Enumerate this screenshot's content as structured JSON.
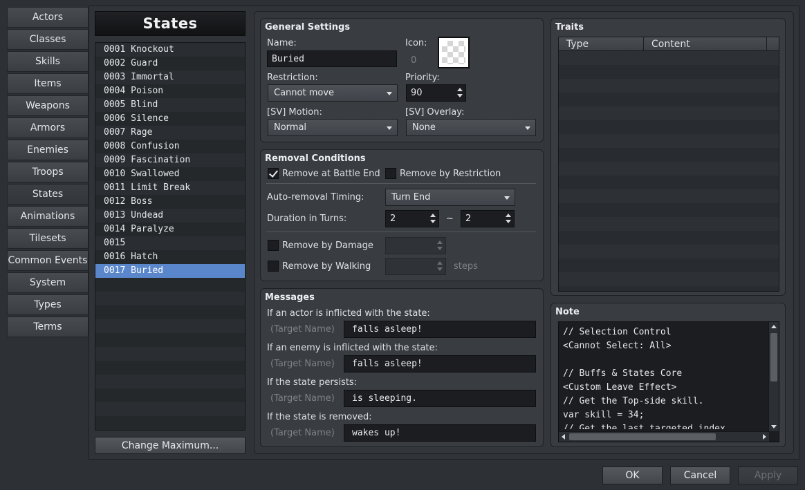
{
  "nav": [
    "Actors",
    "Classes",
    "Skills",
    "Items",
    "Weapons",
    "Armors",
    "Enemies",
    "Troops",
    "States",
    "Animations",
    "Tilesets",
    "Common Events",
    "System",
    "Types",
    "Terms"
  ],
  "nav_active": "States",
  "list_title": "States",
  "states": [
    "0001 Knockout",
    "0002 Guard",
    "0003 Immortal",
    "0004 Poison",
    "0005 Blind",
    "0006 Silence",
    "0007 Rage",
    "0008 Confusion",
    "0009 Fascination",
    "0010 Swallowed",
    "0011 Limit Break",
    "0012 Boss",
    "0013 Undead",
    "0014 Paralyze",
    "0015",
    "0016 Hatch",
    "0017 Buried"
  ],
  "selected_index": 16,
  "change_max_label": "Change Maximum...",
  "general": {
    "header": "General Settings",
    "name_label": "Name:",
    "name_value": "Buried",
    "icon_label": "Icon:",
    "icon_index": "0",
    "restriction_label": "Restriction:",
    "restriction_value": "Cannot move",
    "priority_label": "Priority:",
    "priority_value": "90",
    "sv_motion_label": "[SV] Motion:",
    "sv_motion_value": "Normal",
    "sv_overlay_label": "[SV] Overlay:",
    "sv_overlay_value": "None"
  },
  "removal": {
    "header": "Removal Conditions",
    "battle_end_label": "Remove at Battle End",
    "battle_end_checked": true,
    "restriction_label": "Remove by Restriction",
    "restriction_checked": false,
    "timing_label": "Auto-removal Timing:",
    "timing_value": "Turn End",
    "duration_label": "Duration in Turns:",
    "duration_min": "2",
    "tilde": "~",
    "duration_max": "2",
    "damage_label": "Remove by Damage",
    "walking_label": "Remove by Walking",
    "steps_label": "steps"
  },
  "messages": {
    "header": "Messages",
    "target_name": "(Target Name)",
    "items": [
      {
        "label": "If an actor is inflicted with the state:",
        "value": "falls asleep!"
      },
      {
        "label": "If an enemy is inflicted with the state:",
        "value": "falls asleep!"
      },
      {
        "label": "If the state persists:",
        "value": "is sleeping."
      },
      {
        "label": "If the state is removed:",
        "value": "wakes up!"
      }
    ]
  },
  "traits": {
    "header": "Traits",
    "col_type": "Type",
    "col_content": "Content"
  },
  "note": {
    "header": "Note",
    "lines": [
      "// Selection Control",
      "<Cannot Select: All>",
      "",
      "// Buffs & States Core",
      "<Custom Leave Effect>",
      "// Get the Top-side skill.",
      "var skill = 34;",
      "// Get the last targeted index"
    ]
  },
  "footer": {
    "ok": "OK",
    "cancel": "Cancel",
    "apply": "Apply"
  }
}
